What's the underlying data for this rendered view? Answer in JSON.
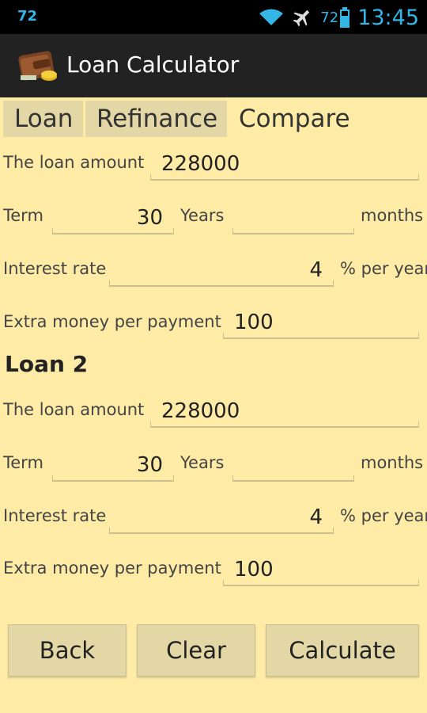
{
  "status_bar": {
    "notification": "72",
    "battery": "72",
    "time": "13:45"
  },
  "app": {
    "title": "Loan Calculator"
  },
  "tabs": [
    {
      "label": "Loan"
    },
    {
      "label": "Refinance"
    },
    {
      "label": "Compare"
    }
  ],
  "loan1": {
    "amount_label": "The loan amount",
    "amount": "228000",
    "term_label": "Term",
    "term_years": "30",
    "years_label": "Years",
    "term_months": "",
    "months_label": "months",
    "rate_label": "Interest rate",
    "rate": "4",
    "rate_unit": "% per year",
    "extra_label": "Extra money per payment",
    "extra": "100"
  },
  "loan2": {
    "title": "Loan 2",
    "amount_label": "The loan amount",
    "amount": "228000",
    "term_label": "Term",
    "term_years": "30",
    "years_label": "Years",
    "term_months": "",
    "months_label": "months",
    "rate_label": "Interest rate",
    "rate": "4",
    "rate_unit": "% per year",
    "extra_label": "Extra money per payment",
    "extra": "100"
  },
  "buttons": {
    "back": "Back",
    "clear": "Clear",
    "calculate": "Calculate"
  },
  "colors": {
    "background": "#fdeba6",
    "accent": "#33b5e5",
    "action_bar": "#222222",
    "button": "#e2d7a5"
  }
}
